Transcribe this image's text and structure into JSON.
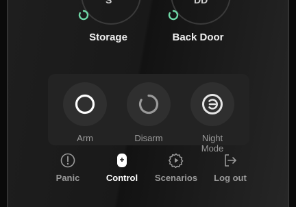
{
  "devices": [
    {
      "label": "Storage",
      "glyph": "S"
    },
    {
      "label": "Back Door",
      "glyph": "DD"
    }
  ],
  "modes": [
    {
      "label": "Arm"
    },
    {
      "label": "Disarm"
    },
    {
      "label": "Night Mode"
    }
  ],
  "nav": [
    {
      "label": "Panic",
      "icon": "exclamation-circle-icon"
    },
    {
      "label": "Control",
      "icon": "remote-control-icon",
      "active": true
    },
    {
      "label": "Scenarios",
      "icon": "scenario-gear-icon"
    },
    {
      "label": "Log out",
      "icon": "logout-icon"
    }
  ],
  "colors": {
    "accent": "#6fd9a8",
    "active_text": "#ffffff",
    "muted_text": "#9a9a9a"
  }
}
